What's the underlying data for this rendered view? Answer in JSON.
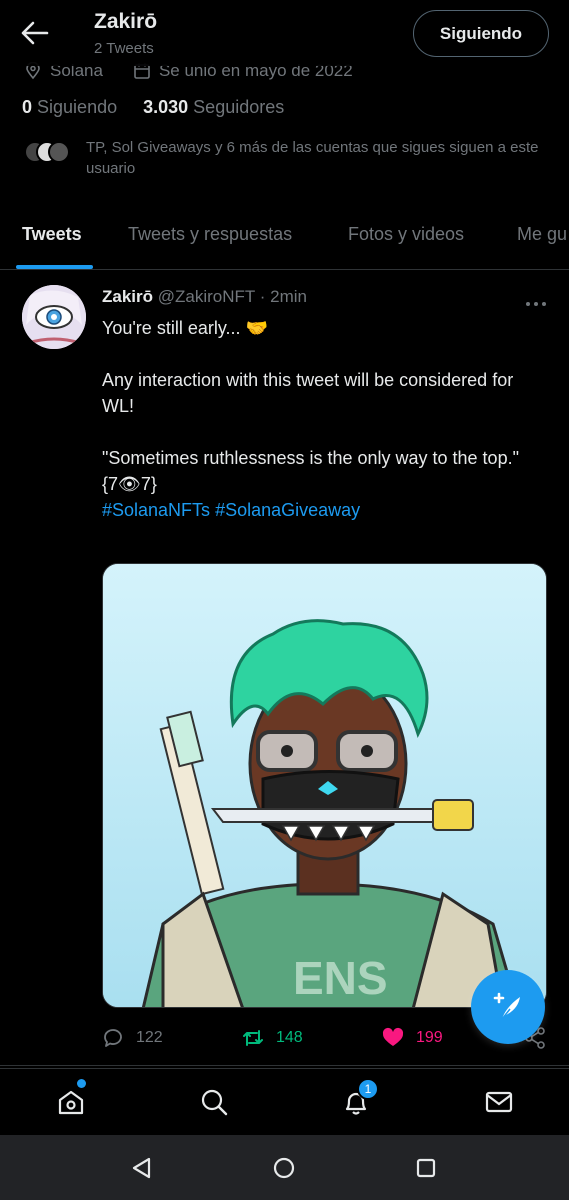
{
  "header": {
    "name": "Zakirō",
    "tweet_count": "2 Tweets",
    "follow_button": "Siguiendo"
  },
  "profile": {
    "location": "Solana",
    "joined": "Se unió en mayo de 2022",
    "following_count": "0",
    "following_label": "Siguiendo",
    "followers_count": "3.030",
    "followers_label": "Seguidores",
    "known_followers": "TP, Sol Giveaways y 6 más de las cuentas que sigues siguen a este usuario"
  },
  "tabs": [
    "Tweets",
    "Tweets y respuestas",
    "Fotos y videos",
    "Me gu"
  ],
  "tweet": {
    "author": "Zakirō",
    "handle": "@ZakiroNFT",
    "separator": "·",
    "time": "2min",
    "line1": "You're still early... 🤝",
    "line2": "Any interaction with this tweet will be considered for WL!",
    "line3": "\"Sometimes ruthlessness is the only way to the top.\"",
    "line4": "{7👁7}",
    "hashtag1": "#SolanaNFTs",
    "hashtag2": "#SolanaGiveaway",
    "replies": "122",
    "retweets": "148",
    "likes": "199"
  },
  "nav": {
    "notifications_badge": "1"
  },
  "colors": {
    "accent": "#1d9bf0",
    "retweet": "#00ba7c",
    "like": "#f91880",
    "muted": "#71767b"
  }
}
